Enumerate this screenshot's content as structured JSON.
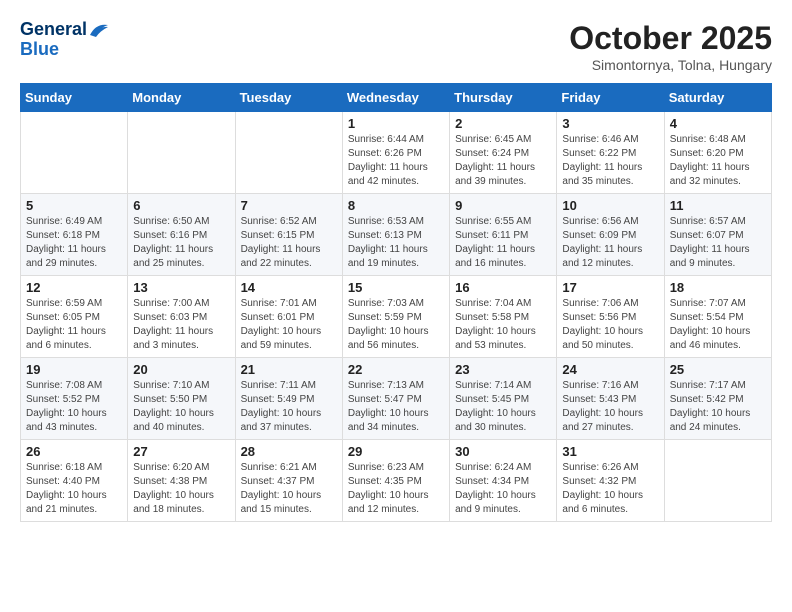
{
  "header": {
    "logo_line1": "General",
    "logo_line2": "Blue",
    "month": "October 2025",
    "location": "Simontornya, Tolna, Hungary"
  },
  "weekdays": [
    "Sunday",
    "Monday",
    "Tuesday",
    "Wednesday",
    "Thursday",
    "Friday",
    "Saturday"
  ],
  "weeks": [
    [
      {
        "day": "",
        "info": ""
      },
      {
        "day": "",
        "info": ""
      },
      {
        "day": "",
        "info": ""
      },
      {
        "day": "1",
        "info": "Sunrise: 6:44 AM\nSunset: 6:26 PM\nDaylight: 11 hours\nand 42 minutes."
      },
      {
        "day": "2",
        "info": "Sunrise: 6:45 AM\nSunset: 6:24 PM\nDaylight: 11 hours\nand 39 minutes."
      },
      {
        "day": "3",
        "info": "Sunrise: 6:46 AM\nSunset: 6:22 PM\nDaylight: 11 hours\nand 35 minutes."
      },
      {
        "day": "4",
        "info": "Sunrise: 6:48 AM\nSunset: 6:20 PM\nDaylight: 11 hours\nand 32 minutes."
      }
    ],
    [
      {
        "day": "5",
        "info": "Sunrise: 6:49 AM\nSunset: 6:18 PM\nDaylight: 11 hours\nand 29 minutes."
      },
      {
        "day": "6",
        "info": "Sunrise: 6:50 AM\nSunset: 6:16 PM\nDaylight: 11 hours\nand 25 minutes."
      },
      {
        "day": "7",
        "info": "Sunrise: 6:52 AM\nSunset: 6:15 PM\nDaylight: 11 hours\nand 22 minutes."
      },
      {
        "day": "8",
        "info": "Sunrise: 6:53 AM\nSunset: 6:13 PM\nDaylight: 11 hours\nand 19 minutes."
      },
      {
        "day": "9",
        "info": "Sunrise: 6:55 AM\nSunset: 6:11 PM\nDaylight: 11 hours\nand 16 minutes."
      },
      {
        "day": "10",
        "info": "Sunrise: 6:56 AM\nSunset: 6:09 PM\nDaylight: 11 hours\nand 12 minutes."
      },
      {
        "day": "11",
        "info": "Sunrise: 6:57 AM\nSunset: 6:07 PM\nDaylight: 11 hours\nand 9 minutes."
      }
    ],
    [
      {
        "day": "12",
        "info": "Sunrise: 6:59 AM\nSunset: 6:05 PM\nDaylight: 11 hours\nand 6 minutes."
      },
      {
        "day": "13",
        "info": "Sunrise: 7:00 AM\nSunset: 6:03 PM\nDaylight: 11 hours\nand 3 minutes."
      },
      {
        "day": "14",
        "info": "Sunrise: 7:01 AM\nSunset: 6:01 PM\nDaylight: 10 hours\nand 59 minutes."
      },
      {
        "day": "15",
        "info": "Sunrise: 7:03 AM\nSunset: 5:59 PM\nDaylight: 10 hours\nand 56 minutes."
      },
      {
        "day": "16",
        "info": "Sunrise: 7:04 AM\nSunset: 5:58 PM\nDaylight: 10 hours\nand 53 minutes."
      },
      {
        "day": "17",
        "info": "Sunrise: 7:06 AM\nSunset: 5:56 PM\nDaylight: 10 hours\nand 50 minutes."
      },
      {
        "day": "18",
        "info": "Sunrise: 7:07 AM\nSunset: 5:54 PM\nDaylight: 10 hours\nand 46 minutes."
      }
    ],
    [
      {
        "day": "19",
        "info": "Sunrise: 7:08 AM\nSunset: 5:52 PM\nDaylight: 10 hours\nand 43 minutes."
      },
      {
        "day": "20",
        "info": "Sunrise: 7:10 AM\nSunset: 5:50 PM\nDaylight: 10 hours\nand 40 minutes."
      },
      {
        "day": "21",
        "info": "Sunrise: 7:11 AM\nSunset: 5:49 PM\nDaylight: 10 hours\nand 37 minutes."
      },
      {
        "day": "22",
        "info": "Sunrise: 7:13 AM\nSunset: 5:47 PM\nDaylight: 10 hours\nand 34 minutes."
      },
      {
        "day": "23",
        "info": "Sunrise: 7:14 AM\nSunset: 5:45 PM\nDaylight: 10 hours\nand 30 minutes."
      },
      {
        "day": "24",
        "info": "Sunrise: 7:16 AM\nSunset: 5:43 PM\nDaylight: 10 hours\nand 27 minutes."
      },
      {
        "day": "25",
        "info": "Sunrise: 7:17 AM\nSunset: 5:42 PM\nDaylight: 10 hours\nand 24 minutes."
      }
    ],
    [
      {
        "day": "26",
        "info": "Sunrise: 6:18 AM\nSunset: 4:40 PM\nDaylight: 10 hours\nand 21 minutes."
      },
      {
        "day": "27",
        "info": "Sunrise: 6:20 AM\nSunset: 4:38 PM\nDaylight: 10 hours\nand 18 minutes."
      },
      {
        "day": "28",
        "info": "Sunrise: 6:21 AM\nSunset: 4:37 PM\nDaylight: 10 hours\nand 15 minutes."
      },
      {
        "day": "29",
        "info": "Sunrise: 6:23 AM\nSunset: 4:35 PM\nDaylight: 10 hours\nand 12 minutes."
      },
      {
        "day": "30",
        "info": "Sunrise: 6:24 AM\nSunset: 4:34 PM\nDaylight: 10 hours\nand 9 minutes."
      },
      {
        "day": "31",
        "info": "Sunrise: 6:26 AM\nSunset: 4:32 PM\nDaylight: 10 hours\nand 6 minutes."
      },
      {
        "day": "",
        "info": ""
      }
    ]
  ]
}
